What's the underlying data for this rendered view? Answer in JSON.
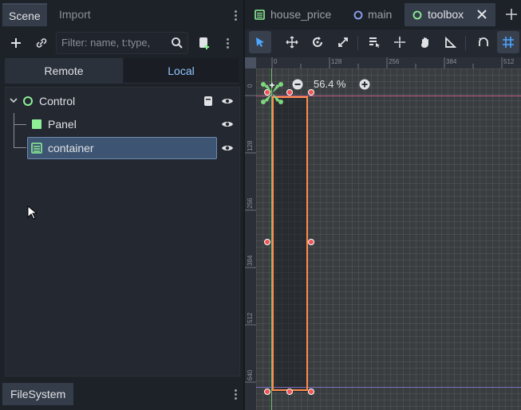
{
  "scene_dock": {
    "tabs": [
      "Scene",
      "Import"
    ],
    "filter_placeholder": "Filter: name, t:type,",
    "modes": [
      "Remote",
      "Local"
    ],
    "tree": {
      "root": "Control",
      "children": [
        "Panel",
        "container"
      ]
    },
    "bottom_tab": "FileSystem"
  },
  "editor": {
    "tabs": [
      "house_price",
      "main",
      "toolbox"
    ],
    "zoom": "56.4 %",
    "ruler_top": [
      "0",
      "128",
      "256",
      "384",
      "512"
    ],
    "ruler_left": [
      "0",
      "128",
      "256",
      "384",
      "512",
      "640"
    ]
  },
  "colors": {
    "accent": "#4da6ff",
    "selection": "#3d5573",
    "node_green": "#8eef97",
    "panel_green": "#8eef97",
    "bounds_orange": "#ff8c4a",
    "handle_red": "#f05555"
  }
}
